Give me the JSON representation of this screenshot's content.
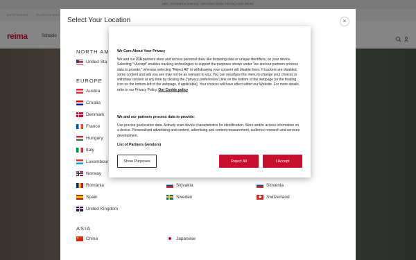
{
  "promo": "VEC OUVERTS SNEGS: INFORMATION FRANÇAISE HERE",
  "topnav": [
    "ENTDECKEN",
    "SUSTAINABILITY"
  ],
  "brand": "reima",
  "nav": {
    "school": "Schoolo"
  },
  "location_modal": {
    "title": "Select Your Location",
    "close": "×",
    "regions": {
      "north_america": "NORTH AM",
      "europe": "EUROPE",
      "asia": "ASIA"
    },
    "countries": {
      "us": "United Sta",
      "austria": "Austria",
      "croatia": "Croatia",
      "denmark": "Denmark",
      "france": "France",
      "hungary": "Hungary",
      "italy": "Italy",
      "luxembourg": "Luxembour",
      "norway": "Norway",
      "romania": "Romania",
      "slovakia": "Slovakia",
      "slovenia": "Slovenia",
      "spain": "Spain",
      "sweden": "Sweden",
      "switzerland": "Switzerland",
      "uk": "United Kingdom",
      "china": "China",
      "japanese": "Japanese"
    }
  },
  "cookie": {
    "title": "We Care About Your Privacy",
    "body_1": "We and our ",
    "partners_count": "219",
    "body_2": " partners store and access personal data, like browsing data or unique identifiers, on your device. Selecting \"I Accept\" enables tracking technologies to support the purposes shown under \"we and our partners process data to provide,\" whereas selecting \"Reject All\" or withdrawing your consent will disable them. If trackers are disabled, some content and ads you see may not be as relevant to you. You can resurface this menu to change your choices or withdraw consent at any time by clicking the [\"privacy preferences\"] link on the bottom of the webpage [or the floating icon on the bottom-left of the webpage, if applicable]. Your choices will have effect within our Website. For more details, refer to our Privacy Policy. ",
    "policy_link": "Our Cookie policy",
    "subtitle": "We and our partners process data to provide:",
    "body_3": "Use precise geolocation data. Actively scan device characteristics for identification. Store and/or access information on a device. Personalised advertising and content, advertising and content measurement, audience research and services development.",
    "partners_link": "List of Partners (vendors)",
    "btn_purposes": "Show Purposes",
    "btn_reject": "Reject All",
    "btn_accept": "I Accept"
  },
  "colors": {
    "brand_red": "#c8102e"
  }
}
